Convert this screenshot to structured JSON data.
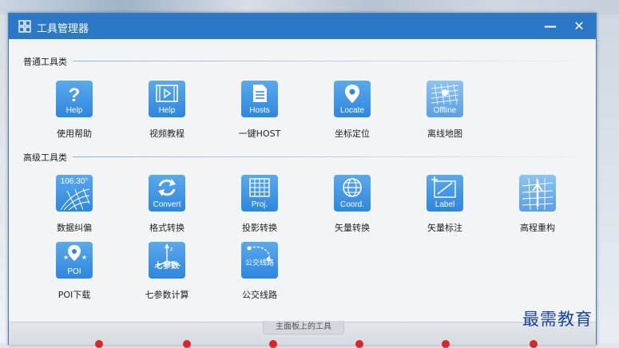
{
  "window": {
    "title": "工具管理器",
    "minimize_glyph": "—",
    "close_glyph": "✕"
  },
  "sections": {
    "common": "普通工具类",
    "advanced": "高级工具类"
  },
  "common_tools": [
    {
      "name": "使用帮助",
      "caption": "Help",
      "icon": "help-icon"
    },
    {
      "name": "视频教程",
      "caption": "Help",
      "icon": "video-icon"
    },
    {
      "name": "一键HOST",
      "caption": "Hosts",
      "icon": "hosts-document-icon"
    },
    {
      "name": "坐标定位",
      "caption": "Locate",
      "icon": "location-pin-icon"
    },
    {
      "name": "离线地图",
      "caption": "Offline",
      "icon": "offline-map-icon"
    }
  ],
  "advanced_tools": [
    {
      "name": "数据纠偏",
      "caption": "106.30°",
      "icon": "data-correction-icon"
    },
    {
      "name": "格式转换",
      "caption": "Convert",
      "icon": "convert-icon"
    },
    {
      "name": "投影转换",
      "caption": "Proj.",
      "icon": "projection-grid-icon"
    },
    {
      "name": "矢量转换",
      "caption": "Coord.",
      "icon": "globe-icon"
    },
    {
      "name": "矢量标注",
      "caption": "Label",
      "icon": "label-icon"
    },
    {
      "name": "高程重构",
      "caption": "",
      "icon": "elevation-icon"
    },
    {
      "name": "POI下载",
      "caption": "POI",
      "icon": "poi-icon"
    },
    {
      "name": "七参数计算",
      "caption": "七参数",
      "icon": "seven-parameter-icon"
    },
    {
      "name": "公交线路",
      "caption": "公交线路",
      "icon": "bus-route-icon"
    }
  ],
  "bottom_panel": {
    "tab_label": "主面板上的工具"
  },
  "watermark": "最需教育",
  "colors": {
    "titlebar": "#2b78c7",
    "icon_blue": "#2e86de",
    "marker_red": "#e02424"
  }
}
